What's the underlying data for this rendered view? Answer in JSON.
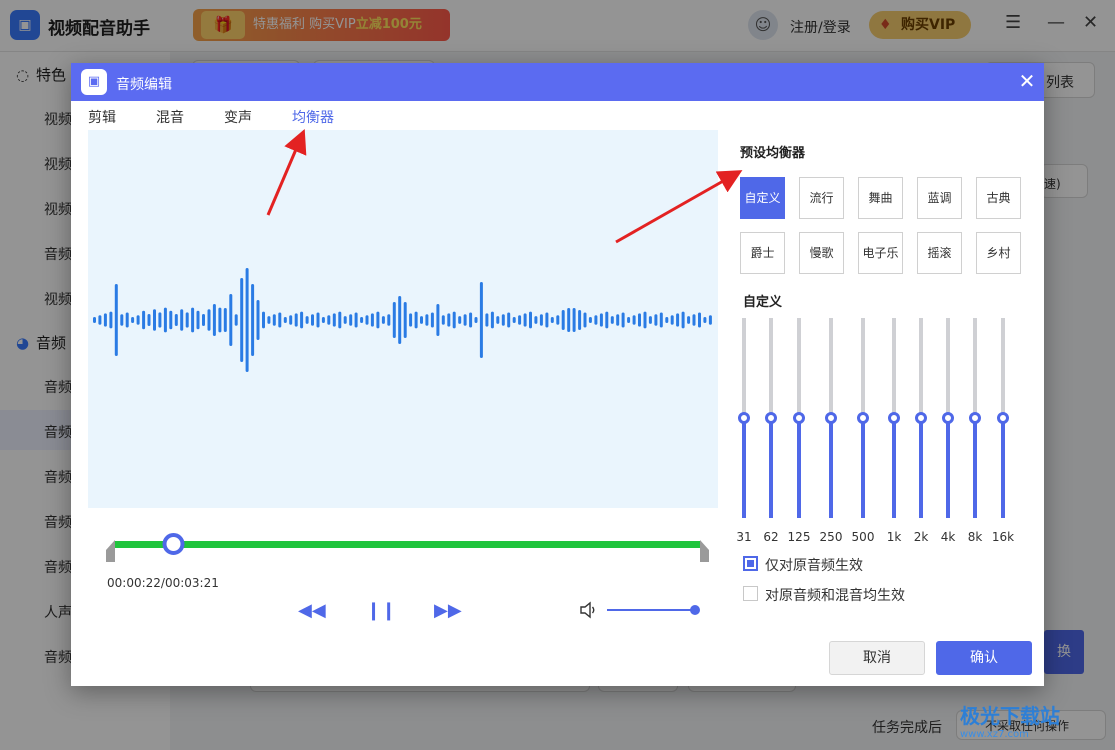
{
  "app": {
    "title": "视频配音助手",
    "promo": {
      "prefix": "特惠福利 购买VIP",
      "highlight": "立减100元"
    },
    "login": "注册/登录",
    "buy_vip": "购买VIP",
    "sidebar": {
      "section1": "特色",
      "section2": "音频",
      "items": [
        "视频",
        "视频",
        "视频",
        "音频",
        "视频",
        "音频",
        "音频",
        "音频",
        "音频",
        "音频",
        "人声",
        "音频"
      ]
    },
    "bg_list_label": "列表",
    "bg_speed_label": "速)",
    "bg_right_btn": "换",
    "task_done_label": "任务完成后",
    "task_done_value": "不采取任何操作"
  },
  "dialog": {
    "title": "音频编辑",
    "tabs": [
      "剪辑",
      "混音",
      "变声",
      "均衡器"
    ],
    "active_tab": 3,
    "time_display": "00:00:22/00:03:21",
    "progress": 0.1,
    "volume": 1.0,
    "controls": {
      "rewind": "rewind",
      "pause": "pause",
      "forward": "fast-forward"
    },
    "eq": {
      "preset_title": "预设均衡器",
      "presets": [
        "自定义",
        "流行",
        "舞曲",
        "蓝调",
        "古典",
        "爵士",
        "慢歌",
        "电子乐",
        "摇滚",
        "乡村"
      ],
      "active_preset": 0,
      "custom_title": "自定义",
      "bands": [
        {
          "label": "31",
          "level": 0.5
        },
        {
          "label": "62",
          "level": 0.5
        },
        {
          "label": "125",
          "level": 0.5
        },
        {
          "label": "250",
          "level": 0.5
        },
        {
          "label": "500",
          "level": 0.5
        },
        {
          "label": "1k",
          "level": 0.5
        },
        {
          "label": "2k",
          "level": 0.5
        },
        {
          "label": "4k",
          "level": 0.5
        },
        {
          "label": "8k",
          "level": 0.5
        },
        {
          "label": "16k",
          "level": 0.5
        }
      ],
      "options": [
        {
          "label": "仅对原音频生效",
          "checked": true
        },
        {
          "label": "对原音频和混音均生效",
          "checked": false
        }
      ]
    },
    "buttons": {
      "cancel": "取消",
      "confirm": "确认"
    }
  },
  "watermark": {
    "text": "极光下载站",
    "sub": "www.xz7.com"
  },
  "colors": {
    "accent": "#4f68e8",
    "progress": "#1fc43c",
    "wave": "#2a7be4",
    "waveform_bg": "#eaf5fd",
    "annotation_arrow": "#e32222"
  }
}
